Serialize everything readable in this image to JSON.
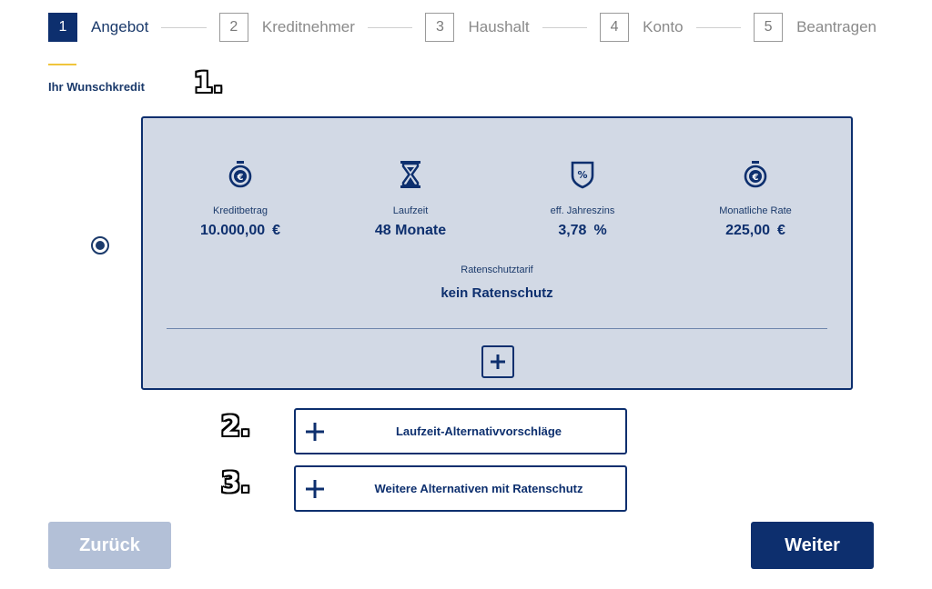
{
  "stepper": {
    "steps": [
      {
        "number": "1",
        "label": "Angebot",
        "active": true
      },
      {
        "number": "2",
        "label": "Kreditnehmer",
        "active": false
      },
      {
        "number": "3",
        "label": "Haushalt",
        "active": false
      },
      {
        "number": "4",
        "label": "Konto",
        "active": false
      },
      {
        "number": "5",
        "label": "Beantragen",
        "active": false
      }
    ]
  },
  "section": {
    "title": "Ihr Wunschkredit"
  },
  "annotations": {
    "one": "1.",
    "two": "2.",
    "three": "3."
  },
  "offer": {
    "selected": true,
    "metrics": [
      {
        "icon": "euro-stopwatch-icon",
        "label": "Kreditbetrag",
        "value": "10.000,00",
        "unit": "€"
      },
      {
        "icon": "hourglass-icon",
        "label": "Laufzeit",
        "value": "48 Monate",
        "unit": ""
      },
      {
        "icon": "percent-shield-icon",
        "label": "eff. Jahreszins",
        "value": "3,78",
        "unit": "%"
      },
      {
        "icon": "euro-stopwatch-icon",
        "label": "Monatliche Rate",
        "value": "225,00",
        "unit": "€"
      }
    ],
    "ratenschutz": {
      "label": "Ratenschutztarif",
      "value": "kein Ratenschutz"
    },
    "expand_icon": "plus-icon"
  },
  "alternatives": {
    "term": "Laufzeit-Alternativvorschläge",
    "insurance": "Weitere Alternativen mit Ratenschutz"
  },
  "nav": {
    "back": "Zurück",
    "next": "Weiter"
  },
  "colors": {
    "primary": "#0d2f6e",
    "card_bg": "#d2d9e5",
    "back_btn": "#b3c0d7",
    "accent": "#f0c53c"
  }
}
